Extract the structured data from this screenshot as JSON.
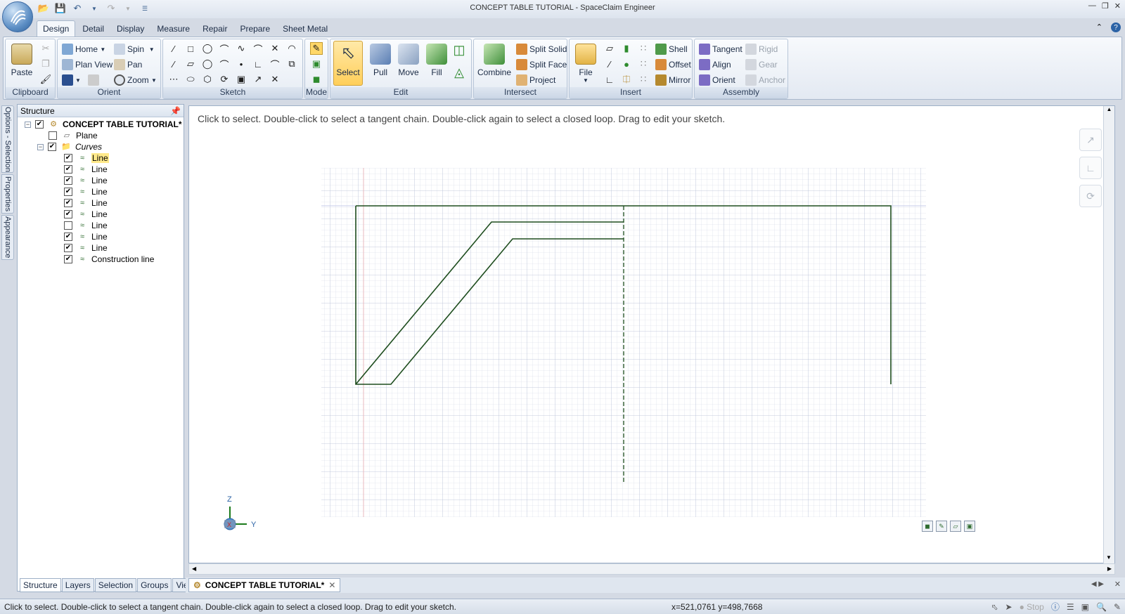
{
  "window": {
    "title": "CONCEPT TABLE TUTORIAL - SpaceClaim Engineer"
  },
  "ribbon_tabs": [
    "Design",
    "Detail",
    "Display",
    "Measure",
    "Repair",
    "Prepare",
    "Sheet Metal"
  ],
  "groups": {
    "clipboard": {
      "label": "Clipboard",
      "paste": "Paste"
    },
    "orient": {
      "label": "Orient",
      "home": "Home",
      "plan_view": "Plan View",
      "spin": "Spin",
      "pan": "Pan",
      "zoom": "Zoom"
    },
    "sketch": {
      "label": "Sketch"
    },
    "mode": {
      "label": "Mode"
    },
    "edit": {
      "label": "Edit",
      "select": "Select",
      "pull": "Pull",
      "move": "Move",
      "fill": "Fill"
    },
    "intersect": {
      "label": "Intersect",
      "combine": "Combine",
      "split_solid": "Split Solid",
      "split_face": "Split Face",
      "project": "Project"
    },
    "insert": {
      "label": "Insert",
      "file": "File",
      "shell": "Shell",
      "offset": "Offset",
      "mirror": "Mirror"
    },
    "assembly": {
      "label": "Assembly",
      "tangent": "Tangent",
      "align": "Align",
      "orient": "Orient",
      "rigid": "Rigid",
      "gear": "Gear",
      "anchor": "Anchor"
    }
  },
  "side_tabs": [
    "Options - Selection",
    "Properties",
    "Appearance"
  ],
  "structure": {
    "title": "Structure",
    "root": "CONCEPT TABLE TUTORIAL*",
    "plane": "Plane",
    "curves": "Curves",
    "items": [
      {
        "label": "Line",
        "checked": true
      },
      {
        "label": "Line",
        "checked": true
      },
      {
        "label": "Line",
        "checked": true
      },
      {
        "label": "Line",
        "checked": true
      },
      {
        "label": "Line",
        "checked": true
      },
      {
        "label": "Line",
        "checked": true
      },
      {
        "label": "Line",
        "checked": false
      },
      {
        "label": "Line",
        "checked": true
      },
      {
        "label": "Line",
        "checked": true
      },
      {
        "label": "Construction line",
        "checked": true
      }
    ],
    "bottom_tabs": [
      "Structure",
      "Layers",
      "Selection",
      "Groups",
      "Views"
    ]
  },
  "viewport": {
    "hint": "Click to select. Double-click to select a tangent chain. Double-click again to select a closed loop. Drag to edit your sketch.",
    "axis_z": "Z",
    "axis_y": "Y",
    "axis_x": "X"
  },
  "doc_tab": "CONCEPT TABLE TUTORIAL*",
  "status": {
    "text": "Click to select. Double-click to select a tangent chain. Double-click again to select a closed loop. Drag to edit your sketch.",
    "coords": "x=521,0761  y=498,7668",
    "stop": "Stop"
  },
  "colors": {
    "sketch_line": "#1e4d1e",
    "grid": "#c9cfe0",
    "accent": "#2c63a6"
  }
}
